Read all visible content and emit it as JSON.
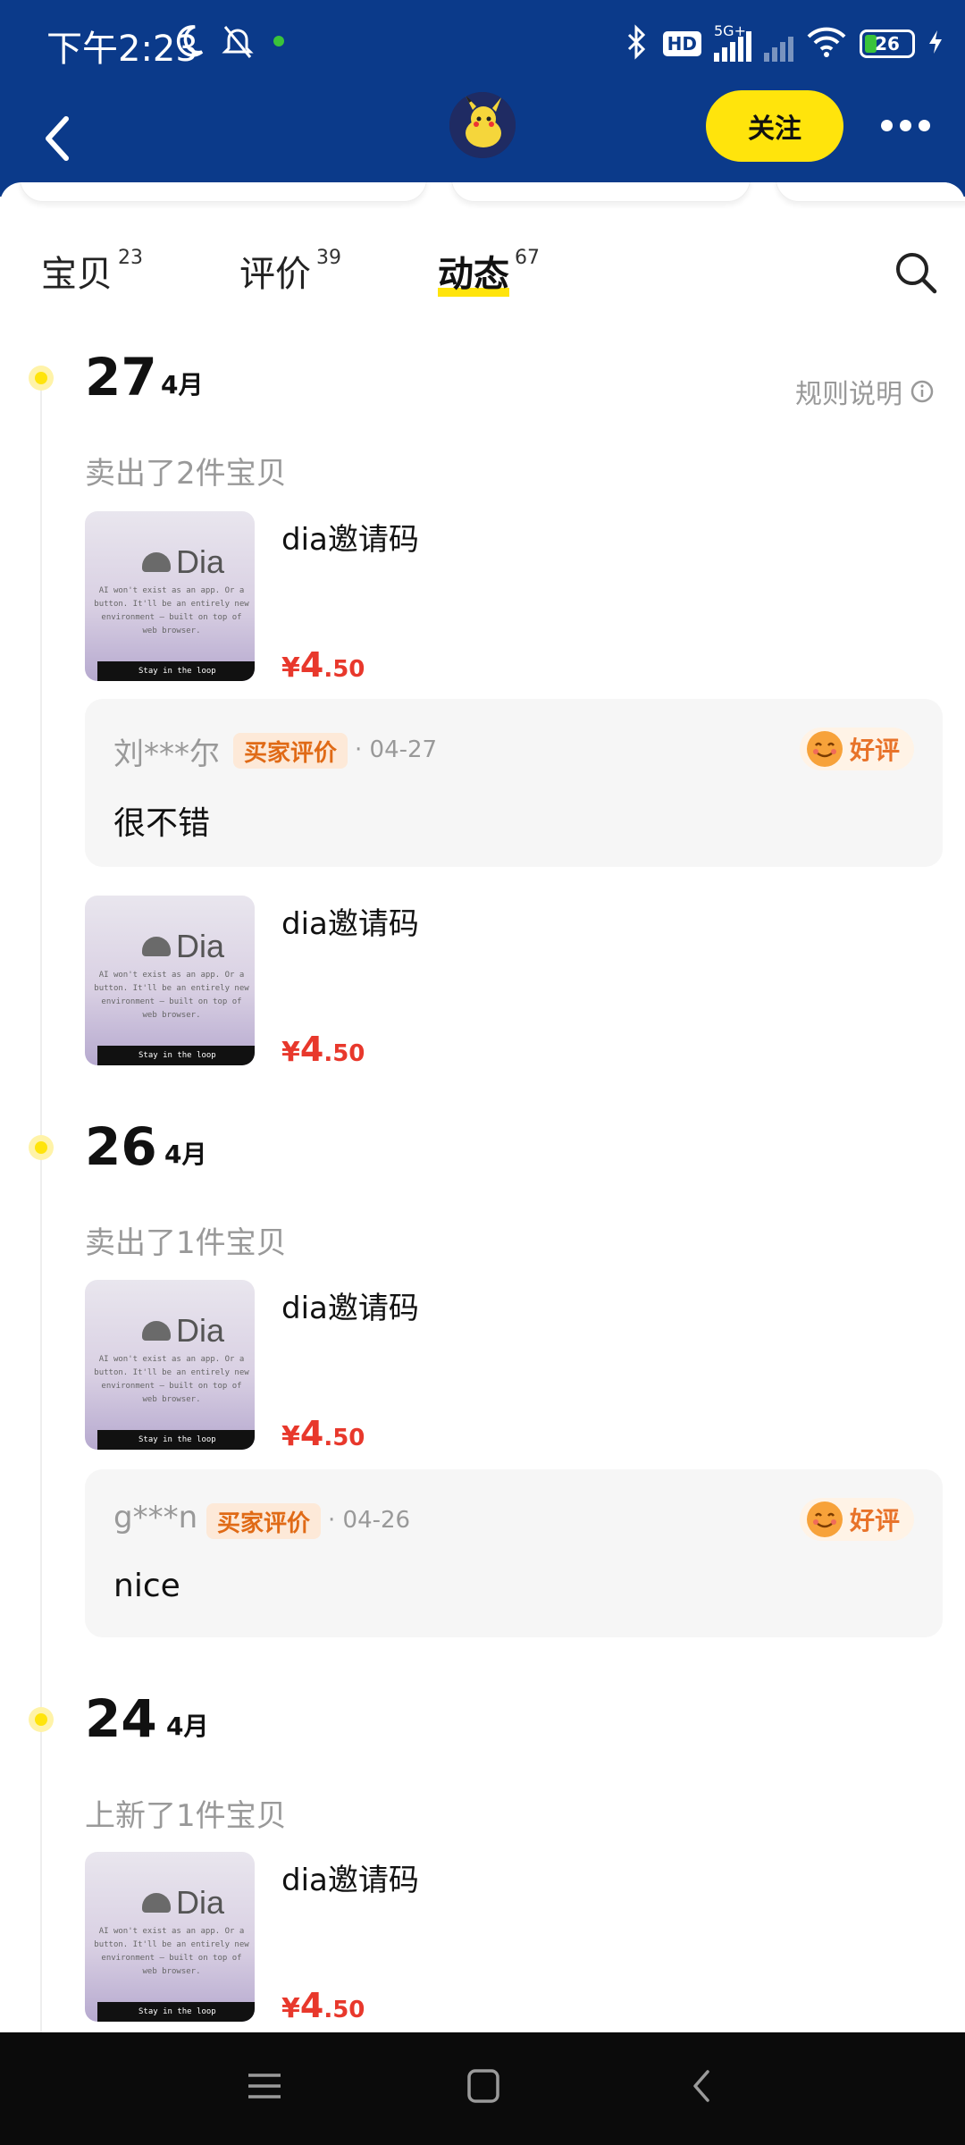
{
  "status": {
    "time": "下午2:23",
    "network": "5G+",
    "hd": "HD",
    "battery": "26"
  },
  "nav": {
    "follow_label": "关注"
  },
  "tabs": [
    {
      "label": "宝贝",
      "count": "23"
    },
    {
      "label": "评价",
      "count": "39"
    },
    {
      "label": "动态",
      "count": "67",
      "active": true
    }
  ],
  "rules_label": "规则说明",
  "groups": [
    {
      "day": "27",
      "month": "4月",
      "summary": "卖出了2件宝贝",
      "items": [
        {
          "title": "dia邀请码",
          "price_symbol": "¥",
          "price_int": "4",
          "price_dec": ".50"
        },
        {
          "title": "dia邀请码",
          "price_symbol": "¥",
          "price_int": "4",
          "price_dec": ".50"
        }
      ],
      "review": {
        "user": "刘***尔",
        "badge": "买家评价",
        "date": "· 04-27",
        "rating": "好评",
        "text": "很不错"
      }
    },
    {
      "day": "26",
      "month": "4月",
      "summary": "卖出了1件宝贝",
      "items": [
        {
          "title": "dia邀请码",
          "price_symbol": "¥",
          "price_int": "4",
          "price_dec": ".50"
        }
      ],
      "review": {
        "user": "g***n",
        "badge": "买家评价",
        "date": "· 04-26",
        "rating": "好评",
        "text": "nice"
      }
    },
    {
      "day": "24",
      "month": "4月",
      "summary": "上新了1件宝贝",
      "items": [
        {
          "title": "dia邀请码",
          "price_symbol": "¥",
          "price_int": "4",
          "price_dec": ".50"
        }
      ]
    }
  ],
  "thumb": {
    "brand": "Dia",
    "lines": [
      "AI won't exist as an app. Or a",
      "button. It'll be an entirely new",
      "environment — built on top of",
      "web browser."
    ],
    "footer": "Stay in the loop"
  },
  "colors": {
    "header_bg": "#0b3a8a",
    "accent_yellow": "#ffe40c",
    "price_red": "#e8382c"
  }
}
